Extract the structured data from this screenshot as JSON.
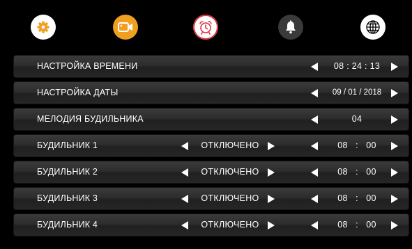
{
  "tabs": [
    {
      "name": "settings",
      "icon": "gear-icon",
      "bg": "#ffffff",
      "fg": "#f0a020"
    },
    {
      "name": "video",
      "icon": "video-camera-icon",
      "bg": "#f0a020",
      "fg": "#ffffff"
    },
    {
      "name": "alarm",
      "icon": "alarm-clock-icon",
      "bg": "#ffffff",
      "fg": "#e03040",
      "active": true
    },
    {
      "name": "notification",
      "icon": "bell-icon",
      "bg": "#3a3a3a",
      "fg": "#ffffff"
    },
    {
      "name": "language",
      "icon": "globe-icon",
      "bg": "#ffffff",
      "fg": "#000000"
    }
  ],
  "rows": {
    "time": {
      "label": "НАСТРОЙКА ВРЕМЕНИ",
      "value": "08 : 24 : 13"
    },
    "date": {
      "label": "НАСТРОЙКА ДАТЫ",
      "value": "09 / 01 / 2018"
    },
    "melody": {
      "label": "МЕЛОДИЯ БУДИЛЬНИКА",
      "value": "04"
    },
    "alarm1": {
      "label": "БУДИЛЬНИК 1",
      "state": "ОТКЛЮЧЕНО",
      "value": "08   :   00"
    },
    "alarm2": {
      "label": "БУДИЛЬНИК 2",
      "state": "ОТКЛЮЧЕНО",
      "value": "08   :   00"
    },
    "alarm3": {
      "label": "БУДИЛЬНИК 3",
      "state": "ОТКЛЮЧЕНО",
      "value": "08   :   00"
    },
    "alarm4": {
      "label": "БУДИЛЬНИК 4",
      "state": "ОТКЛЮЧЕНО",
      "value": "08   :   00"
    }
  }
}
